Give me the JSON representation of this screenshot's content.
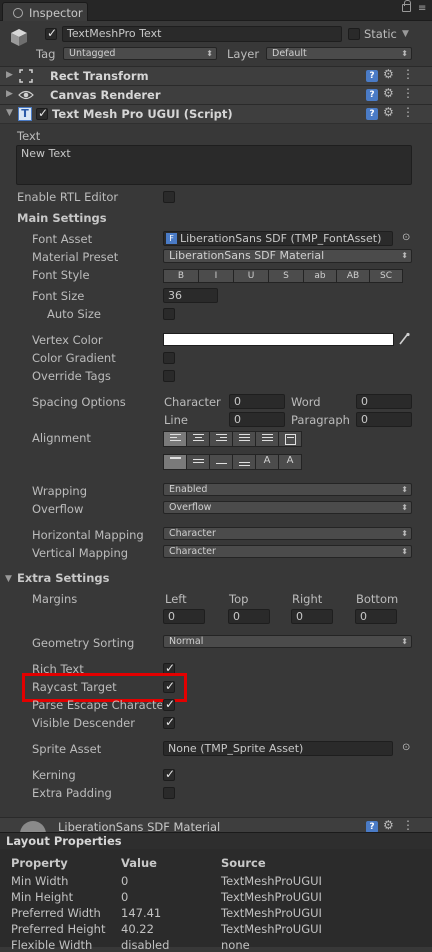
{
  "tab": {
    "label": "Inspector"
  },
  "gameobject": {
    "name": "TextMeshPro Text",
    "static_label": "Static",
    "tag_label": "Tag",
    "tag_value": "Untagged",
    "layer_label": "Layer",
    "layer_value": "Default"
  },
  "components": {
    "rect_transform": "Rect Transform",
    "canvas_renderer": "Canvas Renderer",
    "tmp": "Text Mesh Pro UGUI (Script)",
    "material_name": "LiberationSans SDF Material",
    "help_glyph": "?"
  },
  "text": {
    "label": "Text",
    "value": "New Text"
  },
  "rtl": {
    "label": "Enable RTL Editor"
  },
  "main_settings": {
    "title": "Main Settings",
    "font_asset_label": "Font Asset",
    "font_asset_value": "LiberationSans SDF (TMP_FontAsset)",
    "material_preset_label": "Material Preset",
    "material_preset_value": "LiberationSans SDF Material",
    "font_style_label": "Font Style",
    "font_styles": [
      "B",
      "I",
      "U",
      "S",
      "ab",
      "AB",
      "SC"
    ],
    "font_size_label": "Font Size",
    "font_size_value": "36",
    "auto_size_label": "Auto Size",
    "vertex_color_label": "Vertex Color",
    "vertex_color_value": "#ffffff",
    "color_gradient_label": "Color Gradient",
    "override_tags_label": "Override Tags",
    "spacing_label": "Spacing Options",
    "character_label": "Character",
    "character_value": "0",
    "word_label": "Word",
    "word_value": "0",
    "line_label": "Line",
    "line_value": "0",
    "paragraph_label": "Paragraph",
    "paragraph_value": "0",
    "alignment_label": "Alignment",
    "wrapping_label": "Wrapping",
    "wrapping_value": "Enabled",
    "overflow_label": "Overflow",
    "overflow_value": "Overflow",
    "hmap_label": "Horizontal Mapping",
    "hmap_value": "Character",
    "vmap_label": "Vertical Mapping",
    "vmap_value": "Character"
  },
  "extra_settings": {
    "title": "Extra Settings",
    "margins_label": "Margins",
    "left_label": "Left",
    "top_label": "Top",
    "right_label": "Right",
    "bottom_label": "Bottom",
    "left_value": "0",
    "top_value": "0",
    "right_value": "0",
    "bottom_value": "0",
    "geometry_label": "Geometry Sorting",
    "geometry_value": "Normal",
    "rich_text_label": "Rich Text",
    "raycast_label": "Raycast Target",
    "parse_escape_label": "Parse Escape Characte",
    "visible_descender_label": "Visible Descender",
    "sprite_asset_label": "Sprite Asset",
    "sprite_asset_value": "None (TMP_Sprite Asset)",
    "kerning_label": "Kerning",
    "extra_padding_label": "Extra Padding"
  },
  "layout_properties": {
    "title": "Layout Properties",
    "headers": [
      "Property",
      "Value",
      "Source"
    ],
    "rows": [
      [
        "Min Width",
        "0",
        "TextMeshProUGUI"
      ],
      [
        "Min Height",
        "0",
        "TextMeshProUGUI"
      ],
      [
        "Preferred Width",
        "147.41",
        "TextMeshProUGUI"
      ],
      [
        "Preferred Height",
        "40.22",
        "TextMeshProUGUI"
      ],
      [
        "Flexible Width",
        "disabled",
        "none"
      ]
    ]
  },
  "colors": {
    "highlight": "#e30000",
    "help_icon": "#4a7bc6",
    "background": "#383838"
  }
}
